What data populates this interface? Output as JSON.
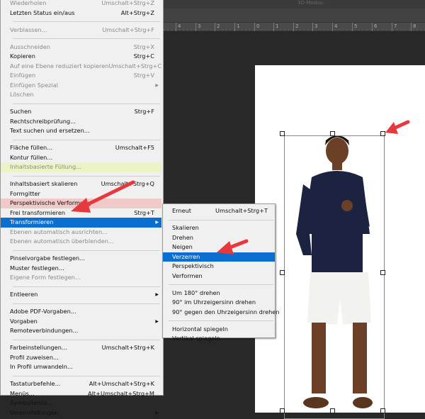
{
  "toolbar": {
    "mode_label": "3D-Modus:"
  },
  "ruler": {
    "labels": [
      "4",
      "3",
      "2",
      "1",
      "0",
      "1",
      "2",
      "3",
      "4",
      "5",
      "6",
      "7",
      "8"
    ]
  },
  "edit_menu": {
    "items": [
      {
        "label": "Wiederholen",
        "shortcut": "Umschalt+Strg+Z",
        "disabled": true
      },
      {
        "label": "Letzten Status ein/aus",
        "shortcut": "Alt+Strg+Z"
      },
      {
        "sep": true
      },
      {
        "label": "Verblassen...",
        "shortcut": "Umschalt+Strg+F",
        "disabled": true
      },
      {
        "sep": true
      },
      {
        "label": "Ausschneiden",
        "shortcut": "Strg+X",
        "disabled": true
      },
      {
        "label": "Kopieren",
        "shortcut": "Strg+C"
      },
      {
        "label": "Auf eine Ebene reduziert kopieren",
        "shortcut": "Umschalt+Strg+C",
        "disabled": true
      },
      {
        "label": "Einfügen",
        "shortcut": "Strg+V",
        "disabled": true
      },
      {
        "label": "Einfügen Spezial",
        "disabled": true,
        "submenu": true
      },
      {
        "label": "Löschen",
        "disabled": true
      },
      {
        "sep": true
      },
      {
        "label": "Suchen",
        "shortcut": "Strg+F"
      },
      {
        "label": "Rechtschreibprüfung..."
      },
      {
        "label": "Text suchen und ersetzen..."
      },
      {
        "sep": true
      },
      {
        "label": "Fläche füllen...",
        "shortcut": "Umschalt+F5"
      },
      {
        "label": "Kontur füllen..."
      },
      {
        "label": "Inhaltsbasierte Füllung...",
        "disabled": true,
        "highlight": "yellow"
      },
      {
        "sep": true
      },
      {
        "label": "Inhaltsbasiert skalieren",
        "shortcut": "Umschalt+Strg+Q"
      },
      {
        "label": "Formgitter"
      },
      {
        "label": "Perspektivische Verformung",
        "highlight": "red"
      },
      {
        "label": "Frei transformieren",
        "shortcut": "Strg+T"
      },
      {
        "label": "Transformieren",
        "submenu": true,
        "selected": true
      },
      {
        "label": "Ebenen automatisch ausrichten...",
        "disabled": true
      },
      {
        "label": "Ebenen automatisch überblenden...",
        "disabled": true
      },
      {
        "sep": true
      },
      {
        "label": "Pinselvorgabe festlegen..."
      },
      {
        "label": "Muster festlegen..."
      },
      {
        "label": "Eigene Form festlegen...",
        "disabled": true
      },
      {
        "sep": true
      },
      {
        "label": "Entleeren",
        "submenu": true
      },
      {
        "sep": true
      },
      {
        "label": "Adobe PDF-Vorgaben..."
      },
      {
        "label": "Vorgaben",
        "submenu": true
      },
      {
        "label": "Remoteverbindungen..."
      },
      {
        "sep": true
      },
      {
        "label": "Farbeinstellungen...",
        "shortcut": "Umschalt+Strg+K"
      },
      {
        "label": "Profil zuweisen..."
      },
      {
        "label": "In Profil umwandeln..."
      },
      {
        "sep": true
      },
      {
        "label": "Tastaturbefehle...",
        "shortcut": "Alt+Umschalt+Strg+K"
      },
      {
        "label": "Menüs...",
        "shortcut": "Alt+Umschalt+Strg+M"
      },
      {
        "label": "Symbolleiste..."
      },
      {
        "label": "Voreinstellungen",
        "submenu": true
      }
    ]
  },
  "transform_submenu": {
    "items": [
      {
        "label": "Erneut",
        "shortcut": "Umschalt+Strg+T"
      },
      {
        "sep": true
      },
      {
        "label": "Skalieren"
      },
      {
        "label": "Drehen"
      },
      {
        "label": "Neigen"
      },
      {
        "label": "Verzerren",
        "selected": true
      },
      {
        "label": "Perspektivisch"
      },
      {
        "label": "Verformen"
      },
      {
        "sep": true
      },
      {
        "label": "Um 180° drehen"
      },
      {
        "label": "90° im Uhrzeigersinn drehen"
      },
      {
        "label": "90° gegen den Uhrzeigersinn drehen"
      },
      {
        "sep": true
      },
      {
        "label": "Horizontal spiegeln"
      },
      {
        "label": "Vertikal spiegeln"
      }
    ]
  },
  "colors": {
    "selection": "#0a6fd1",
    "annotation_arrow": "#e8383d",
    "menu_bg": "#f0f0f0",
    "workspace": "#282828"
  }
}
